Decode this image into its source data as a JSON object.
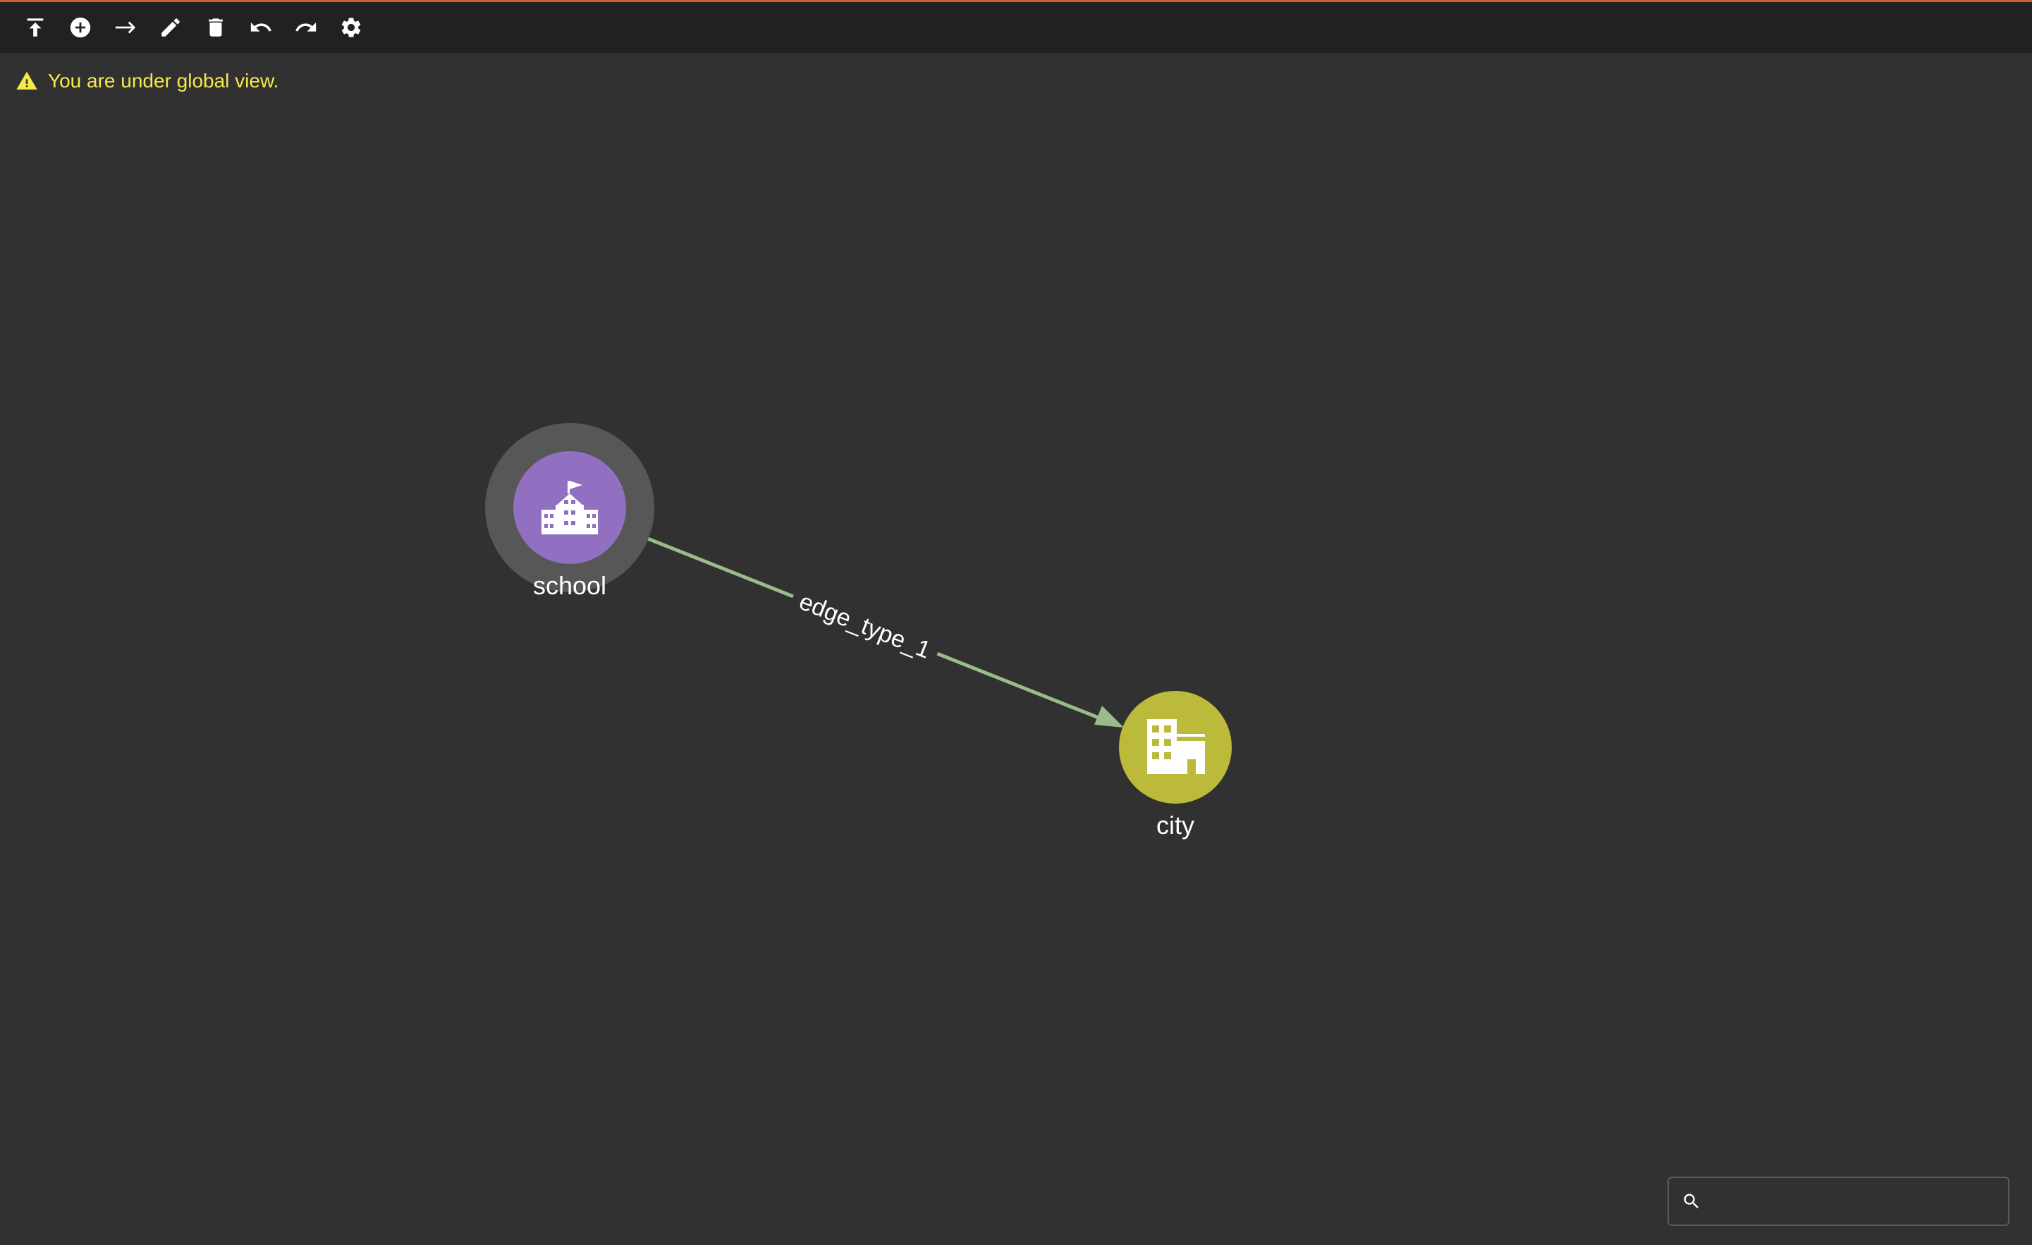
{
  "toolbar": {
    "buttons": [
      {
        "name": "upload-icon"
      },
      {
        "name": "add-circle-icon"
      },
      {
        "name": "arrow-right-icon"
      },
      {
        "name": "pencil-icon"
      },
      {
        "name": "trash-icon"
      },
      {
        "name": "undo-icon"
      },
      {
        "name": "redo-icon"
      },
      {
        "name": "gear-icon"
      }
    ]
  },
  "banner": {
    "text": "You are under global view."
  },
  "graph": {
    "nodes": [
      {
        "id": "school",
        "label": "school",
        "color": "#9170c2",
        "icon": "school-icon",
        "selected": true
      },
      {
        "id": "city",
        "label": "city",
        "color": "#bcba3b",
        "icon": "city-building-icon",
        "selected": false
      }
    ],
    "edges": [
      {
        "from": "school",
        "to": "city",
        "label": "edge_type_1",
        "color": "#98bc8a"
      }
    ]
  },
  "search": {
    "value": "",
    "placeholder": ""
  },
  "colors": {
    "background": "#313131",
    "toolbar": "#212121",
    "accent_border": "#c8622a",
    "warning_text": "#f6e94a"
  }
}
